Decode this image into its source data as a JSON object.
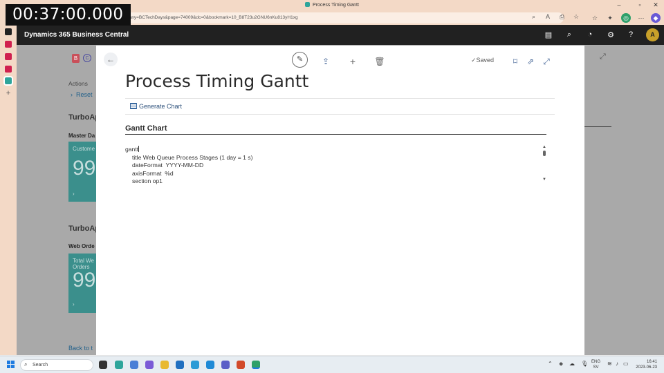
{
  "browser": {
    "tab_title": "Process Timing Gantt",
    "url": "ompany=BCTechDays&page=74009&dc=0&bookmark=10_B8T23u2GNU6nKu813yH1xg"
  },
  "timer": "00:37:00.000",
  "bc_header": {
    "app_name": "Dynamics 365 Business Central",
    "avatar_initial": "A"
  },
  "background_page": {
    "badge_b": "B",
    "badge_c": "C",
    "actions_label": "Actions",
    "reset_label": "Reset",
    "group1": "TurboAp",
    "sub1": "Master Da",
    "tile1_caption": "Custome",
    "tile1_value": "99",
    "group2": "TurboAp",
    "sub2": "Web Orde",
    "tile2_caption_1": "Total We",
    "tile2_caption_2": "Orders",
    "tile2_value": "99",
    "back_link": "Back to t"
  },
  "modal": {
    "status": "Saved",
    "title": "Process Timing Gantt",
    "action_generate": "Generate Chart",
    "section_title": "Gantt Chart",
    "code_lines": [
      "gantt",
      "title Web Queue Process Stages (1 day = 1 s)",
      "dateFormat  YYYY-MM-DD",
      "axisFormat  %d",
      "section op1"
    ]
  },
  "taskbar": {
    "search_placeholder": "Search",
    "lang_line1": "ENG",
    "lang_line2": "SV",
    "time": "16:41",
    "date": "2023-06-23"
  }
}
